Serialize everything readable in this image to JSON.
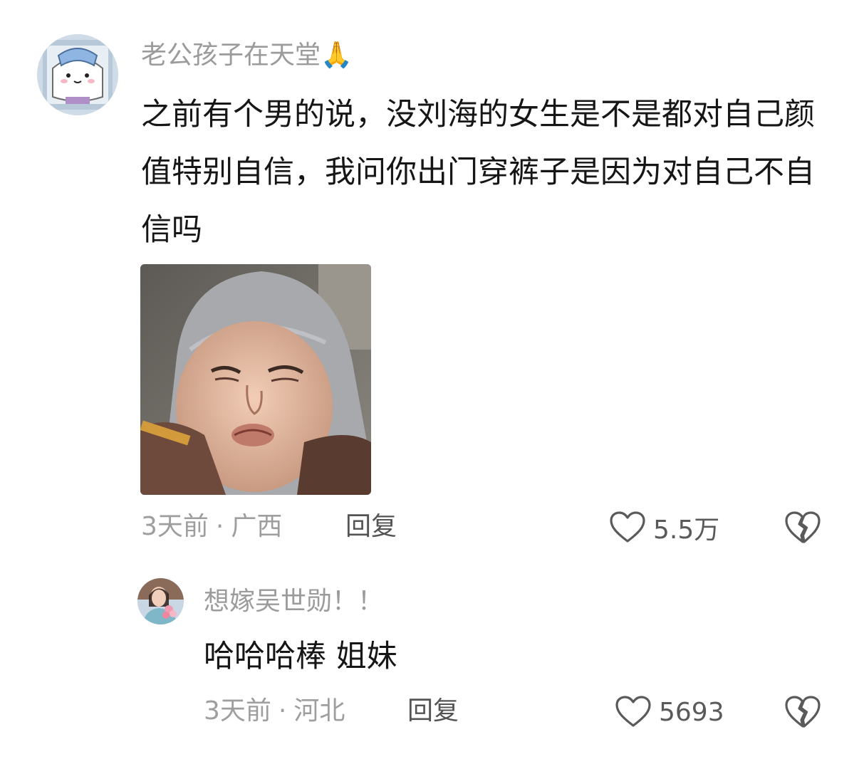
{
  "comment": {
    "username": "老公孩子在天堂🙏",
    "text": "之前有个男的说，没刘海的女生是不是都对自己颜值特别自信，我问你出门穿裤子是因为对自己不自信吗",
    "time": "3天前",
    "location": "广西",
    "separator": "·",
    "reply_label": "回复",
    "like_count": "5.5万",
    "icons": {
      "avatar": "cartoon-avatar",
      "image": "meme-photo",
      "like": "heart-outline-icon",
      "dislike": "broken-heart-icon"
    }
  },
  "reply": {
    "username": "想嫁吴世勋！！",
    "text": "哈哈哈棒 姐妹",
    "time": "3天前",
    "location": "河北",
    "separator": "·",
    "reply_label": "回复",
    "like_count": "5693",
    "icons": {
      "avatar": "photo-avatar",
      "like": "heart-outline-icon",
      "dislike": "broken-heart-icon"
    }
  },
  "colors": {
    "text": "#161616",
    "muted": "#9b9b9b",
    "action": "#545454"
  }
}
